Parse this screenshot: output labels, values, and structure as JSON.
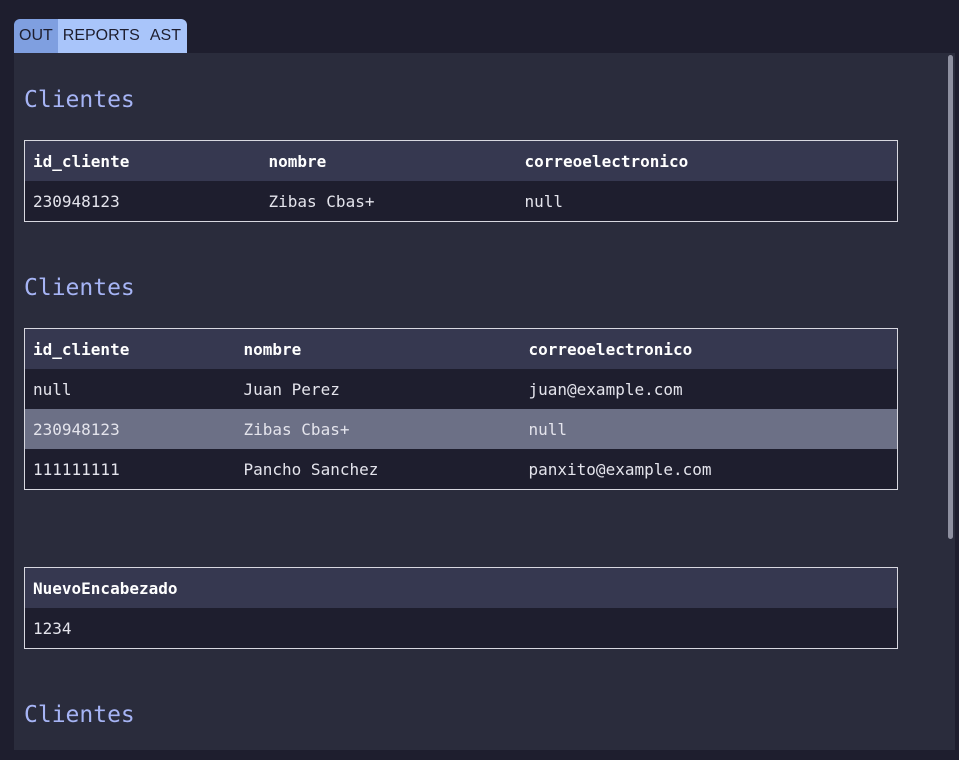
{
  "tabs": [
    {
      "label": "OUT"
    },
    {
      "label": "REPORTS"
    },
    {
      "label": "AST"
    }
  ],
  "sections": [
    {
      "title": "Clientes",
      "columns": [
        "id_cliente",
        "nombre",
        "correoelectronico"
      ],
      "rows": [
        [
          "230948123",
          "Zibas Cbas+",
          "null"
        ]
      ]
    },
    {
      "title": "Clientes",
      "columns": [
        "id_cliente",
        "nombre",
        "correoelectronico"
      ],
      "rows": [
        [
          "null",
          "Juan Perez",
          "juan@example.com"
        ],
        [
          "230948123",
          "Zibas Cbas+",
          "null"
        ],
        [
          "111111111",
          "Pancho Sanchez",
          "panxito@example.com"
        ]
      ],
      "highlighted_row": 1
    },
    {
      "title": "",
      "columns": [
        "NuevoEncabezado"
      ],
      "rows": [
        [
          "1234"
        ]
      ]
    },
    {
      "title": "Clientes"
    }
  ],
  "colors": {
    "background": "#1e1e2e",
    "panel": "#2a2c3c",
    "title": "#a6b4f5",
    "tab_active": "#7f9fe0",
    "tab_inactive": "#a9c5fa",
    "header_row": "#363850",
    "highlight_row": "#6c7086"
  }
}
